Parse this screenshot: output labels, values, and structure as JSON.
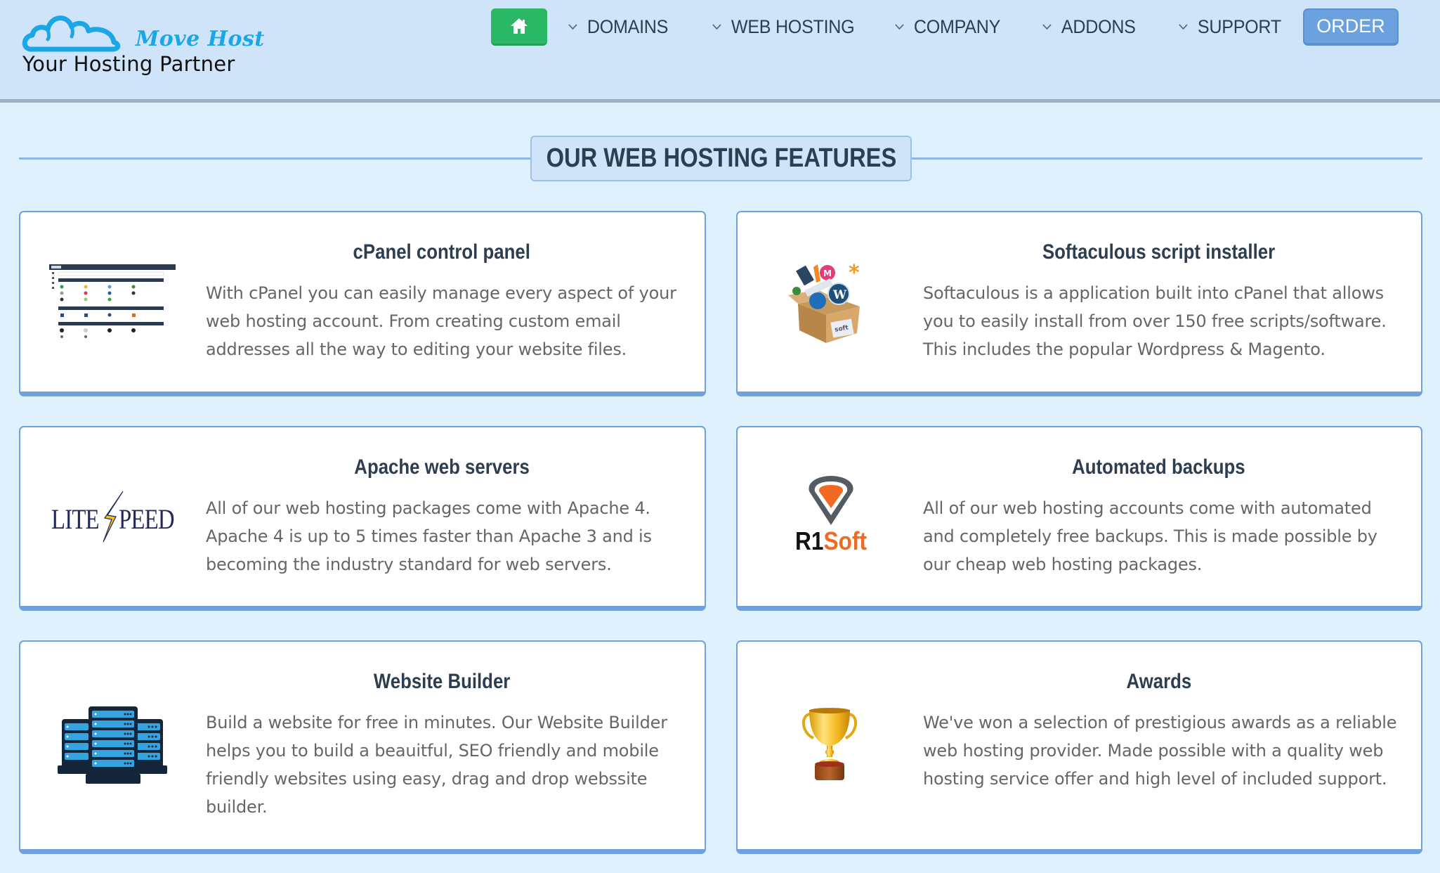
{
  "brand": {
    "name": "Move Host",
    "tagline": "Your Hosting Partner",
    "logo_icon": "cloud-icon",
    "color": "#1ba6e6"
  },
  "nav": {
    "home_icon": "home-icon",
    "items": [
      {
        "label": "DOMAINS",
        "icon": "chevron-down-icon"
      },
      {
        "label": "WEB HOSTING",
        "icon": "chevron-down-icon"
      },
      {
        "label": "COMPANY",
        "icon": "chevron-down-icon"
      },
      {
        "label": "ADDONS",
        "icon": "chevron-down-icon"
      },
      {
        "label": "SUPPORT",
        "icon": "chevron-down-icon"
      }
    ],
    "order_label": "ORDER",
    "home_color": "#2bb866",
    "order_color": "#6ca1e0"
  },
  "section": {
    "title": "OUR WEB HOSTING FEATURES"
  },
  "features": [
    {
      "title": "cPanel control panel",
      "description": "With cPanel you can easily manage every aspect of your web hosting account. From creating custom email addresses all the way to editing your website files.",
      "image": "cpanel-screenshot"
    },
    {
      "title": "Softaculous script installer",
      "description": "Softaculous is a application built into cPanel that allows you to easily install from over 150 free scripts/software. This includes the popular Wordpress & Magento.",
      "image": "softaculous-box-logo"
    },
    {
      "title": "Apache web servers",
      "description": "All of our web hosting packages come with Apache 4. Apache 4 is up to 5 times faster than Apache 3 and is becoming the industry standard for web servers.",
      "image": "litespeed-logo",
      "logo_text": {
        "left": "LITE",
        "right": "PEED"
      }
    },
    {
      "title": "Automated backups",
      "description": "All of our web hosting accounts come with automated and completely free backups. This is made possible by our cheap web hosting packages.",
      "image": "r1soft-logo",
      "logo_text": {
        "left": "R1",
        "right": "Soft"
      }
    },
    {
      "title": "Website Builder",
      "description": "Build a website for free in minutes. Our Website Builder helps you to build a beauitful, SEO friendly and mobile friendly websites using easy, drag and drop webssite builder.",
      "image": "server-rack-icon"
    },
    {
      "title": "Awards",
      "description": "We've won a selection of prestigious awards as a reliable web hosting provider. Made possible with a quality web hosting service offer and high level of included support.",
      "image": "trophy-icon"
    }
  ]
}
